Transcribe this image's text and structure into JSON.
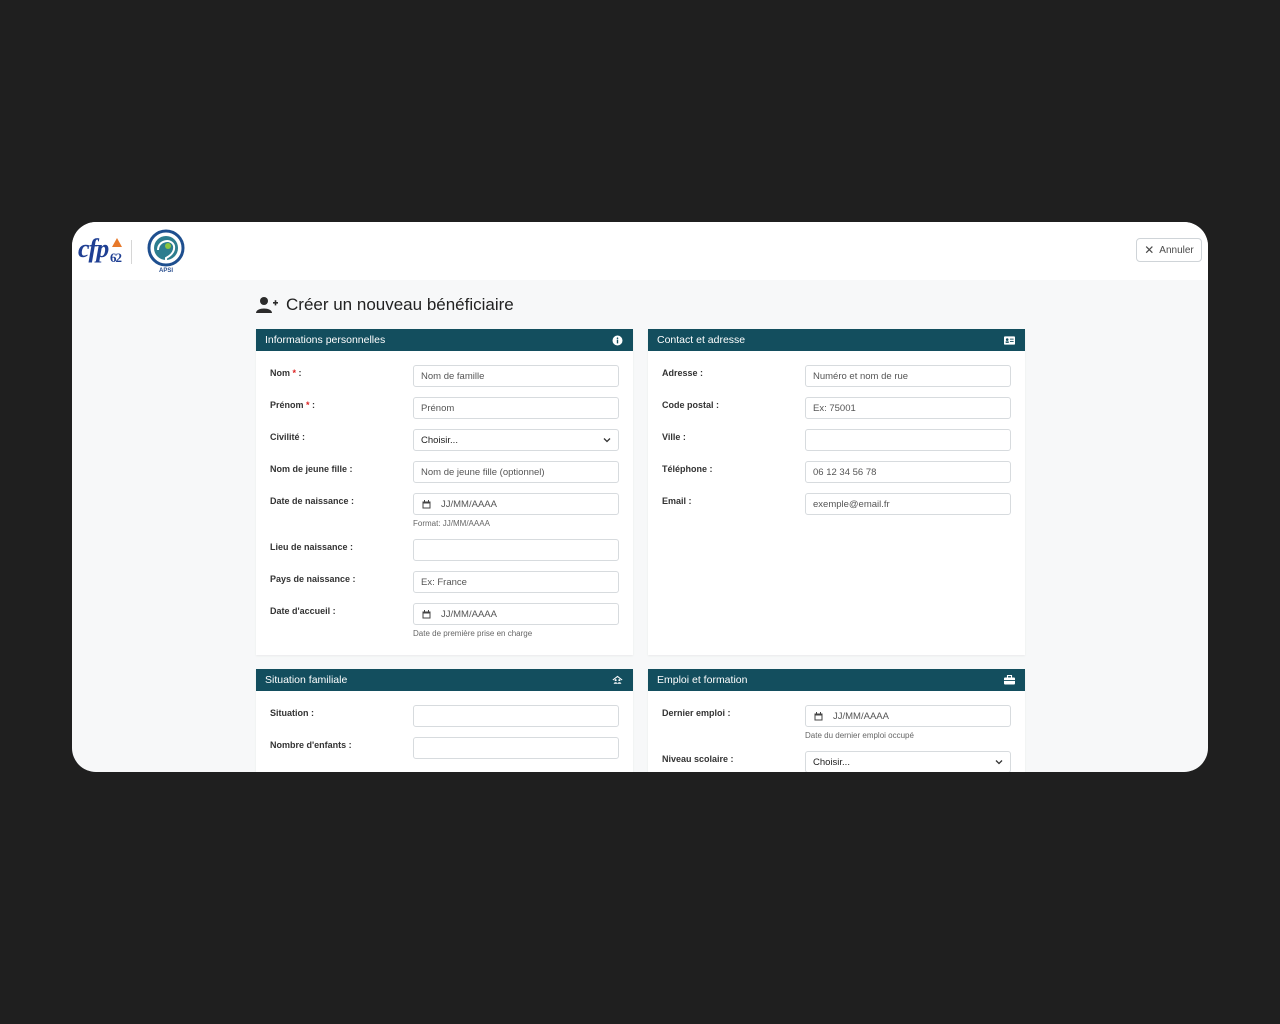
{
  "header": {
    "logo_left_text": "cfp",
    "logo_left_num": "62",
    "logo_right_text": "APSI",
    "cancel_label": "Annuler"
  },
  "page": {
    "title": "Créer un nouveau bénéficiaire"
  },
  "personal": {
    "title": "Informations personnelles",
    "nom_label": "Nom",
    "nom_placeholder": "Nom de famille",
    "prenom_label": "Prénom",
    "prenom_placeholder": "Prénom",
    "civilite_label": "Civilité :",
    "civilite_value": "Choisir...",
    "jeune_fille_label": "Nom de jeune fille :",
    "jeune_fille_placeholder": "Nom de jeune fille (optionnel)",
    "naissance_label": "Date de naissance :",
    "naissance_placeholder": "JJ/MM/AAAA",
    "naissance_help": "Format: JJ/MM/AAAA",
    "lieu_label": "Lieu de naissance :",
    "pays_label": "Pays de naissance :",
    "pays_placeholder": "Ex: France",
    "accueil_label": "Date d'accueil :",
    "accueil_placeholder": "JJ/MM/AAAA",
    "accueil_help": "Date de première prise en charge"
  },
  "contact": {
    "title": "Contact et adresse",
    "adresse_label": "Adresse :",
    "adresse_placeholder": "Numéro et nom de rue",
    "cp_label": "Code postal :",
    "cp_placeholder": "Ex: 75001",
    "ville_label": "Ville :",
    "tel_label": "Téléphone :",
    "tel_placeholder": "06 12 34 56 78",
    "email_label": "Email :",
    "email_placeholder": "exemple@email.fr"
  },
  "family": {
    "title": "Situation familiale",
    "situation_label": "Situation :",
    "enfants_label": "Nombre d'enfants :"
  },
  "employment": {
    "title": "Emploi et formation",
    "dernier_label": "Dernier emploi :",
    "dernier_placeholder": "JJ/MM/AAAA",
    "dernier_help": "Date du dernier emploi occupé",
    "niveau_label": "Niveau scolaire :",
    "niveau_value": "Choisir..."
  },
  "colors": {
    "header_bg": "#134e5e",
    "required": "#dd2222"
  }
}
